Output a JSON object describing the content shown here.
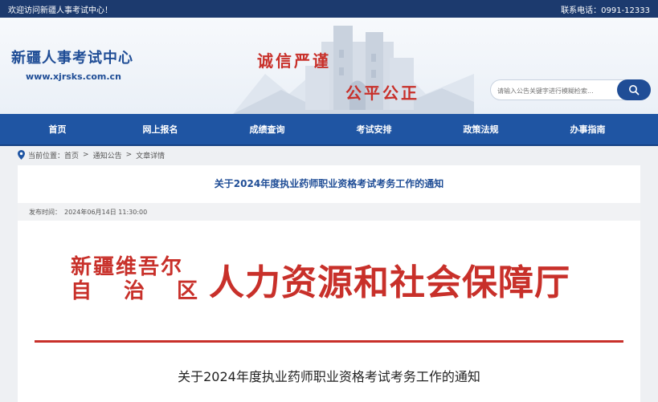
{
  "topbar": {
    "welcome": "欢迎访问新疆人事考试中心！",
    "phone": "联系电话：0991-12333"
  },
  "header": {
    "logo_title": "新疆人事考试中心",
    "logo_url": "www.xjrsks.com.cn",
    "slogan_1": "诚信严谨",
    "slogan_2": "公平公正"
  },
  "search": {
    "placeholder": "请输入公告关键字进行模糊检索...",
    "icon": "search-icon"
  },
  "nav": {
    "items": [
      "首页",
      "网上报名",
      "成绩查询",
      "考试安排",
      "政策法规",
      "办事指南"
    ]
  },
  "breadcrumb": {
    "label": "当前位置：",
    "items": [
      "首页",
      "通知公告",
      "文章详情"
    ],
    "separator": ">"
  },
  "article": {
    "title": "关于2024年度执业药师职业资格考试考务工作的通知",
    "publish_label": "发布时间：",
    "publish_time": "2024年06月14日 11:30:00",
    "doc_org_line1": "新疆维吾尔",
    "doc_org_line2": [
      "自",
      "治",
      "区"
    ],
    "doc_dept": "人力资源和社会保障厅",
    "body_title": "关于2024年度执业药师职业资格考试考务工作的通知"
  },
  "colors": {
    "brand_blue": "#1f55a3",
    "dark_blue": "#1c3a6e",
    "red": "#c8302a"
  }
}
